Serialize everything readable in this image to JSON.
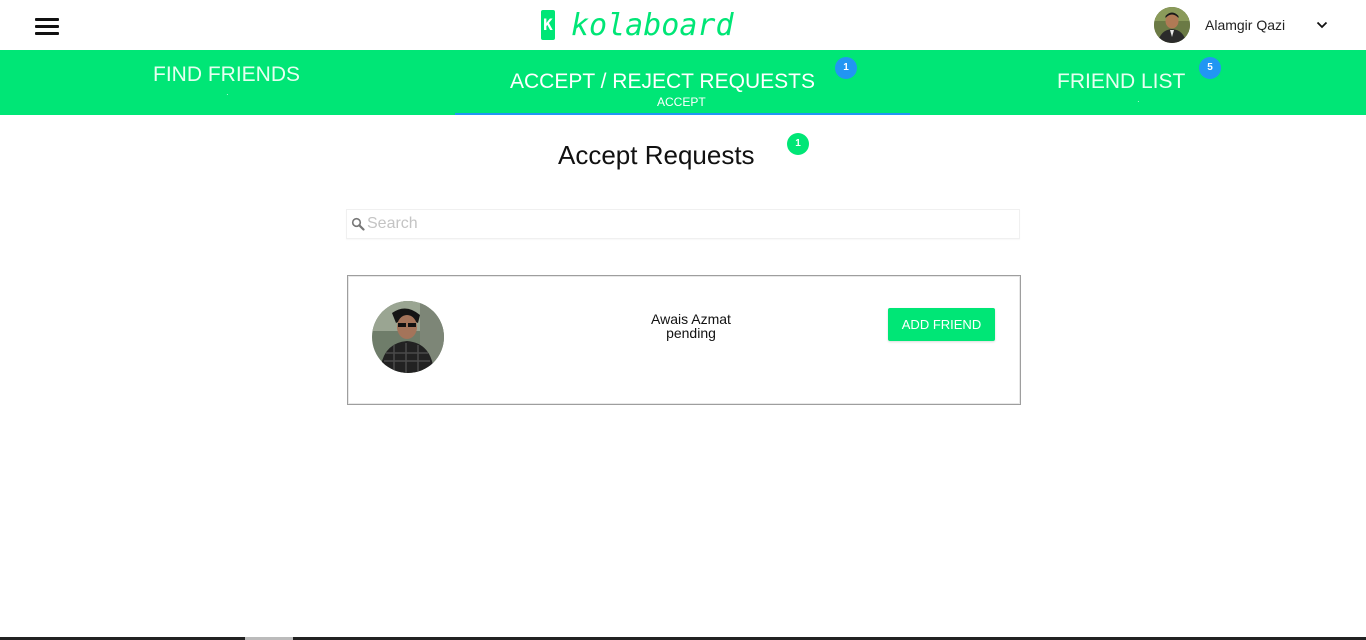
{
  "header": {
    "logo_mark": "K",
    "logo_text": "kolaboard",
    "user_name": "Alamgir Qazi"
  },
  "tabs": [
    {
      "label": "FIND FRIENDS",
      "sub": "",
      "badge": null,
      "active": false
    },
    {
      "label": "ACCEPT / REJECT REQUESTS",
      "sub": "ACCEPT",
      "badge": "1",
      "active": true
    },
    {
      "label": "FRIEND LIST",
      "sub": "",
      "badge": "5",
      "active": false
    }
  ],
  "main": {
    "title": "Accept Requests",
    "title_badge": "1",
    "search": {
      "placeholder": "Search",
      "value": ""
    },
    "requests": [
      {
        "name": "Awais Azmat",
        "status": "pending",
        "action_label": "ADD FRIEND"
      }
    ]
  },
  "colors": {
    "brand_green": "#00e676",
    "badge_blue": "#2196f3"
  },
  "icons": {
    "menu": "hamburger-menu-icon",
    "dropdown": "chevron-down-icon",
    "search": "search-icon"
  }
}
